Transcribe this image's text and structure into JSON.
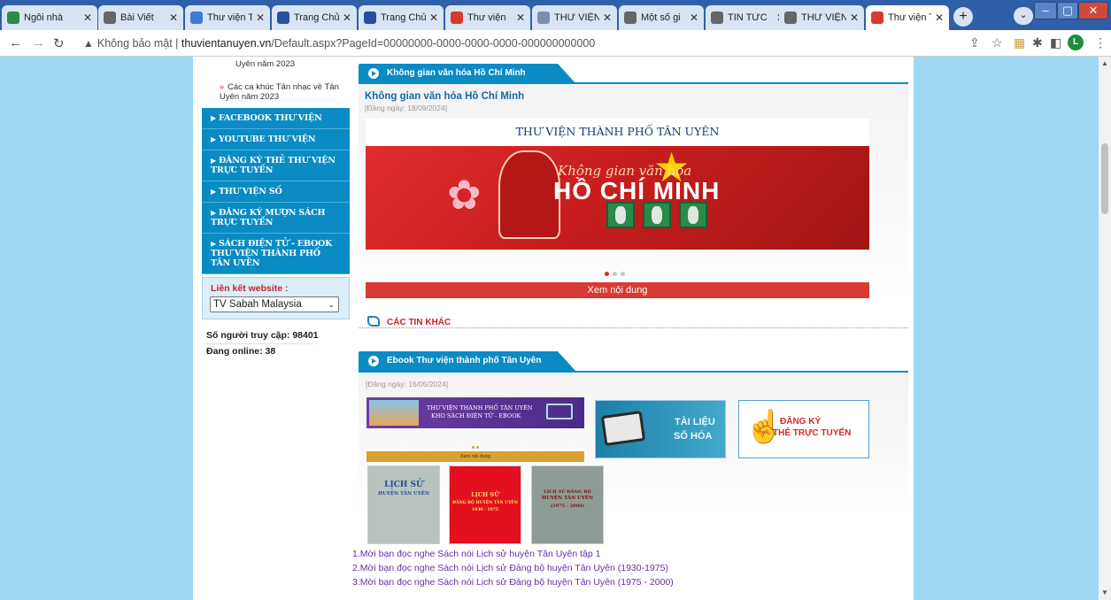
{
  "tabs": [
    {
      "label": "Ngôi nhà",
      "color": "#2c8a4a"
    },
    {
      "label": "Bài Viết",
      "color": "#666666"
    },
    {
      "label": "Thư viện T",
      "color": "#3d7bd6"
    },
    {
      "label": "Trang Chủ",
      "color": "#2a4f9e"
    },
    {
      "label": "Trang Chủ",
      "color": "#2a4f9e"
    },
    {
      "label": "Thư viện",
      "color": "#d63b2f"
    },
    {
      "label": "THƯ VIỆN",
      "color": "#7a8fb0"
    },
    {
      "label": "Một số gi",
      "color": "#666666"
    },
    {
      "label": "TIN TỨC",
      "color": "#666666"
    },
    {
      "label": "THƯ VIỆN",
      "color": "#666666"
    },
    {
      "label": "Thư viện T",
      "color": "#d63b2f",
      "active": true
    }
  ],
  "browser": {
    "new_tab": "+",
    "tab_menu": "⌄",
    "security_warning": "Không bảo mật",
    "url_host": "thuvientanuyen.vn",
    "url_path": "/Default.aspx?PageId=00000000-0000-0000-0000-000000000000",
    "profile_initial": "L"
  },
  "sidebar": {
    "top_text": "Uyên năm 2023",
    "song_link": "Các ca khúc Tân nhạc về Tân Uyên năm 2023",
    "menu": [
      "FACEBOOK THƯ VIỆN",
      "YOUTUBE THƯ VIỆN",
      "ĐĂNG KÝ THẺ THƯ VIỆN TRỰC TUYẾN",
      "THƯ VIỆN SỐ",
      "ĐĂNG KÝ MƯỢN SÁCH TRỰC TUYẾN",
      "SÁCH ĐIỆN TỬ - EBOOK THƯ VIỆN THÀNH PHỐ TÂN UYÊN"
    ],
    "links_label": "Liên kết website :",
    "links_selected": "TV Sabah Malaysia",
    "visits": "Số người truy cập: 98401",
    "online": "Đang online: 38"
  },
  "section1": {
    "header": "Không gian văn hóa Hồ Chí Minh",
    "title": "Không gian văn hóa Hồ Chí Minh",
    "date": "[Đăng ngày: 18/09/2024]",
    "banner_top": "THƯ VIỆN THÀNH PHỐ TÂN UYÊN",
    "banner_script": "Không gian văn hóa",
    "banner_big": "HỒ CHÍ MINH",
    "button": "Xem nội dung"
  },
  "other_news": "CÁC TIN KHÁC",
  "section2": {
    "header": "Ebook Thư viện thành phố Tân Uyên",
    "date": "[Đăng ngày: 16/05/2024]",
    "promo1_line1": "THƯ VIỆN THÀNH PHỐ TÂN UYÊN",
    "promo1_line2": "KHO SÁCH ĐIỆN TỬ - EBOOK",
    "promo1_button": "Xem nội dung",
    "promo2_line1": "TÀI LIỆU",
    "promo2_line2": "SỐ HÓA",
    "promo3_line1": "ĐĂNG KÝ",
    "promo3_line2": "THẺ TRỰC TUYẾN",
    "books": [
      {
        "title": "LỊCH SỬ",
        "subtitle": "HUYỆN TÂN UYÊN"
      },
      {
        "title": "LỊCH SỬ",
        "subtitle": "ĐẢNG BỘ HUYỆN TÂN UYÊN",
        "years": "1930 - 1975"
      },
      {
        "title": "LỊCH SỬ ĐẢNG BỘ",
        "subtitle": "HUYỆN TÂN UYÊN",
        "years": "(1975 - 2000)"
      }
    ],
    "links": [
      "1.Mời bạn đọc nghe Sách nói Lịch sử huyện Tân Uyên tập 1",
      "2.Mời bạn đọc nghe Sách nói Lịch sử Đảng bộ huyện Tân Uyên (1930-1975)",
      "3.Mời bạn đọc nghe Sách nói Lịch sử Đảng bộ huyện Tân Uyên (1975 - 2000)"
    ]
  }
}
